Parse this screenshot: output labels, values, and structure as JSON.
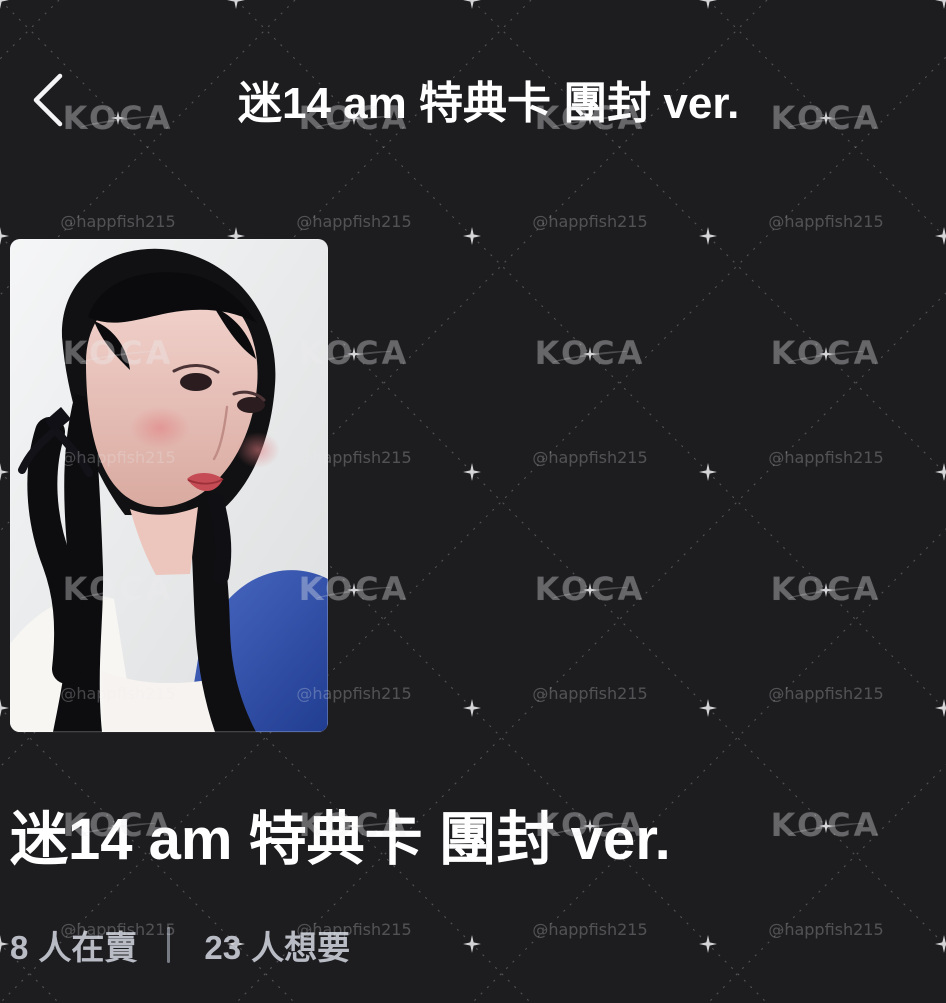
{
  "header": {
    "back_icon": "chevron-left-icon",
    "title": "迷14 am 特典卡 團封 ver."
  },
  "product": {
    "image_alt": "Photocard of a person with dark braided hair and ribbons, posing with a puckered expression",
    "title": "迷14 am 特典卡 團封 ver.",
    "selling_count": "8",
    "selling_label": "人在賣",
    "wanting_count": "23",
    "wanting_label": "人想要"
  },
  "watermarks": {
    "logo_text": "KOCA",
    "handle_text": "@happfish215"
  },
  "colors": {
    "background": "#1d1d20",
    "text_primary": "#ffffff",
    "text_secondary": "#b9bcc4",
    "divider": "#777b84",
    "pattern": "#8d8d91"
  }
}
